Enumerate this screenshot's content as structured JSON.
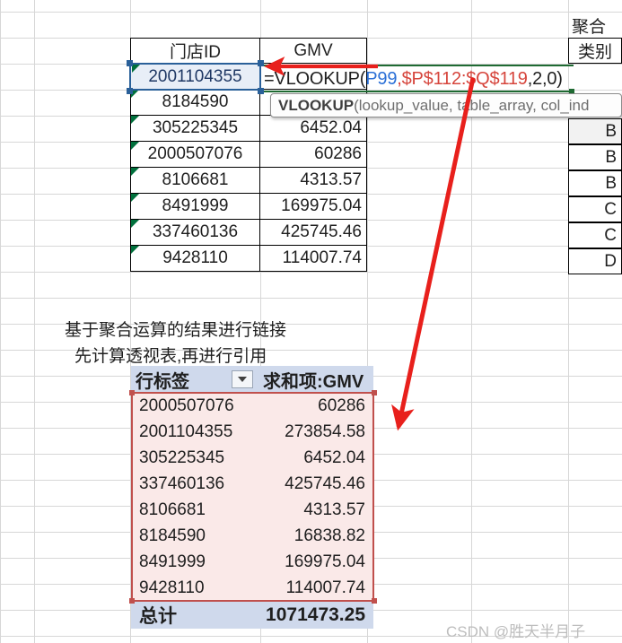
{
  "source_table": {
    "headers": [
      "门店ID",
      "GMV"
    ],
    "rows": [
      {
        "id": "2001104355",
        "gmv": "",
        "comment": true,
        "selected": true
      },
      {
        "id": "8184590",
        "gmv": "",
        "comment": true,
        "selected": false
      },
      {
        "id": "305225345",
        "gmv": "6452.04",
        "comment": true,
        "selected": false
      },
      {
        "id": "2000507076",
        "gmv": "60286",
        "comment": true,
        "selected": false
      },
      {
        "id": "8106681",
        "gmv": "4313.57",
        "comment": true,
        "selected": false
      },
      {
        "id": "8491999",
        "gmv": "169975.04",
        "comment": true,
        "selected": false
      },
      {
        "id": "337460136",
        "gmv": "425745.46",
        "comment": true,
        "selected": false
      },
      {
        "id": "9428110",
        "gmv": "114007.74",
        "comment": true,
        "selected": false
      }
    ]
  },
  "formula": {
    "full_text": "=VLOOKUP(P99,$P$112:$Q$119,2,0)",
    "prefix": "=VLOOKUP(",
    "lookup_value": "P99",
    "comma1": ",",
    "table_array": "$P$112:$Q$119",
    "suffix": ",2,0)",
    "color_lookup_value": "#2a6fd6",
    "color_table_array": "#d6453c"
  },
  "tooltip": {
    "function_name": "VLOOKUP",
    "signature": "(lookup_value, table_array, col_ind"
  },
  "right_table": {
    "title": "聚合",
    "header": "类别",
    "values": [
      "B",
      "B",
      "B",
      "C",
      "C",
      "D"
    ]
  },
  "annotation": {
    "line1": "基于聚合运算的结果进行链接",
    "line2": "先计算透视表,再进行引用"
  },
  "pivot": {
    "row_label_header": "行标签",
    "value_header": "求和项:GMV",
    "filter_icon": "chevron-down-icon",
    "rows": [
      {
        "label": "2000507076",
        "value": "60286"
      },
      {
        "label": "2001104355",
        "value": "273854.58"
      },
      {
        "label": "305225345",
        "value": "6452.04"
      },
      {
        "label": "337460136",
        "value": "425745.46"
      },
      {
        "label": "8106681",
        "value": "4313.57"
      },
      {
        "label": "8184590",
        "value": "16838.82"
      },
      {
        "label": "8491999",
        "value": "169975.04"
      },
      {
        "label": "9428110",
        "value": "114007.74"
      }
    ],
    "total_label": "总计",
    "total_value": "1071473.25",
    "header_bg": "#cfd9ec",
    "body_bg": "#fae9e8",
    "border_color": "#c0504d"
  },
  "arrows": {
    "color": "#e8201c",
    "horizontal_name": "formula-pointer-arrow",
    "diagonal_name": "pivot-link-arrow"
  },
  "watermark": "CSDN @胜天半月子"
}
